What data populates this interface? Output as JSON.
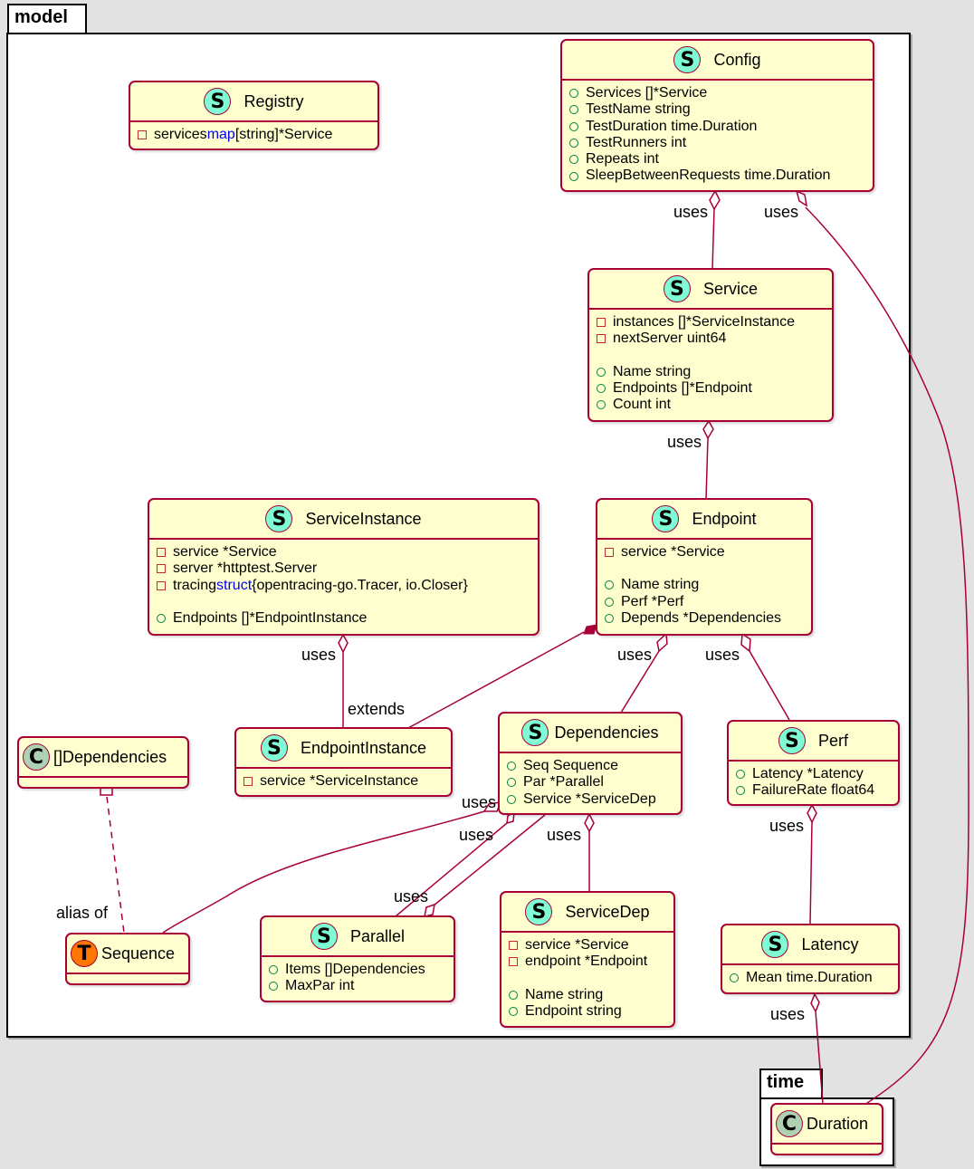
{
  "packages": {
    "model": {
      "name": "model"
    },
    "time": {
      "name": "time"
    }
  },
  "colors": {
    "class_fill": "#fefece",
    "class_border": "#a80036",
    "struct_badge": "#7ffcd4",
    "class_badge": "#add1b2",
    "type_badge": "#ff7700",
    "keyword": "#0000ff",
    "private_marker": "#c82930",
    "public_marker": "#038048"
  },
  "classes": {
    "registry": {
      "badge": "S",
      "name": "Registry",
      "fields": [
        {
          "vis": "private",
          "name": "services ",
          "kw": "map",
          "rest": "[string]*Service"
        }
      ]
    },
    "config": {
      "badge": "S",
      "name": "Config",
      "fields": [
        {
          "vis": "public",
          "text": "Services []*Service"
        },
        {
          "vis": "public",
          "text": "TestName string"
        },
        {
          "vis": "public",
          "text": "TestDuration time.Duration"
        },
        {
          "vis": "public",
          "text": "TestRunners int"
        },
        {
          "vis": "public",
          "text": "Repeats int"
        },
        {
          "vis": "public",
          "text": "SleepBetweenRequests time.Duration"
        }
      ]
    },
    "service": {
      "badge": "S",
      "name": "Service",
      "fields": [
        {
          "vis": "private",
          "text": "instances []*ServiceInstance"
        },
        {
          "vis": "private",
          "text": "nextServer uint64"
        },
        {
          "vis": "public",
          "text": "Name string"
        },
        {
          "vis": "public",
          "text": "Endpoints []*Endpoint"
        },
        {
          "vis": "public",
          "text": "Count int"
        }
      ]
    },
    "service_instance": {
      "badge": "S",
      "name": "ServiceInstance",
      "fields": [
        {
          "vis": "private",
          "text": "service *Service"
        },
        {
          "vis": "private",
          "text": "server *httptest.Server"
        },
        {
          "vis": "private",
          "name": "tracing ",
          "kw": "struct",
          "rest": "{opentracing-go.Tracer, io.Closer}"
        },
        {
          "vis": "public",
          "text": "Endpoints []*EndpointInstance"
        }
      ]
    },
    "endpoint": {
      "badge": "S",
      "name": "Endpoint",
      "fields": [
        {
          "vis": "private",
          "text": "service *Service"
        },
        {
          "vis": "public",
          "text": "Name string"
        },
        {
          "vis": "public",
          "text": "Perf *Perf"
        },
        {
          "vis": "public",
          "text": "Depends *Dependencies"
        }
      ]
    },
    "dependencies_slice": {
      "badge": "C",
      "name": "[]Dependencies"
    },
    "endpoint_instance": {
      "badge": "S",
      "name": "EndpointInstance",
      "fields": [
        {
          "vis": "private",
          "text": "service *ServiceInstance"
        }
      ]
    },
    "dependencies": {
      "badge": "S",
      "name": "Dependencies",
      "fields": [
        {
          "vis": "public",
          "text": "Seq Sequence"
        },
        {
          "vis": "public",
          "text": "Par *Parallel"
        },
        {
          "vis": "public",
          "text": "Service *ServiceDep"
        }
      ]
    },
    "perf": {
      "badge": "S",
      "name": "Perf",
      "fields": [
        {
          "vis": "public",
          "text": "Latency *Latency"
        },
        {
          "vis": "public",
          "text": "FailureRate float64"
        }
      ]
    },
    "sequence": {
      "badge": "T",
      "name": "Sequence"
    },
    "parallel": {
      "badge": "S",
      "name": "Parallel",
      "fields": [
        {
          "vis": "public",
          "text": "Items []Dependencies"
        },
        {
          "vis": "public",
          "text": "MaxPar int"
        }
      ]
    },
    "service_dep": {
      "badge": "S",
      "name": "ServiceDep",
      "fields": [
        {
          "vis": "private",
          "text": "service *Service"
        },
        {
          "vis": "private",
          "text": "endpoint *Endpoint"
        },
        {
          "vis": "public",
          "text": "Name string"
        },
        {
          "vis": "public",
          "text": "Endpoint string"
        }
      ]
    },
    "latency": {
      "badge": "S",
      "name": "Latency",
      "fields": [
        {
          "vis": "public",
          "text": "Mean time.Duration"
        }
      ]
    },
    "duration": {
      "badge": "C",
      "name": "Duration"
    }
  },
  "relations": [
    {
      "from": "Config",
      "to": "Service",
      "type": "aggregation",
      "label": "uses"
    },
    {
      "from": "Config",
      "to": "time.Duration",
      "type": "aggregation",
      "label": "uses"
    },
    {
      "from": "Service",
      "to": "Endpoint",
      "type": "aggregation",
      "label": "uses"
    },
    {
      "from": "ServiceInstance",
      "to": "EndpointInstance",
      "type": "aggregation",
      "label": "uses"
    },
    {
      "from": "Endpoint",
      "to": "EndpointInstance",
      "type": "composition",
      "label": "extends"
    },
    {
      "from": "Endpoint",
      "to": "Dependencies",
      "type": "aggregation",
      "label": "uses"
    },
    {
      "from": "Endpoint",
      "to": "Perf",
      "type": "aggregation",
      "label": "uses"
    },
    {
      "from": "Dependencies",
      "to": "Sequence",
      "type": "aggregation",
      "label": "uses"
    },
    {
      "from": "Dependencies",
      "to": "Parallel",
      "type": "aggregation",
      "label": "uses"
    },
    {
      "from": "Parallel",
      "to": "Dependencies",
      "type": "aggregation",
      "label": "uses"
    },
    {
      "from": "Dependencies",
      "to": "ServiceDep",
      "type": "aggregation",
      "label": "uses"
    },
    {
      "from": "Perf",
      "to": "Latency",
      "type": "aggregation",
      "label": "uses"
    },
    {
      "from": "Latency",
      "to": "time.Duration",
      "type": "aggregation",
      "label": "uses"
    },
    {
      "from": "[]Dependencies",
      "to": "Sequence",
      "type": "dashed",
      "label": "alias of"
    }
  ],
  "labels": {
    "uses": "uses",
    "extends": "extends",
    "alias_of": "alias of"
  }
}
